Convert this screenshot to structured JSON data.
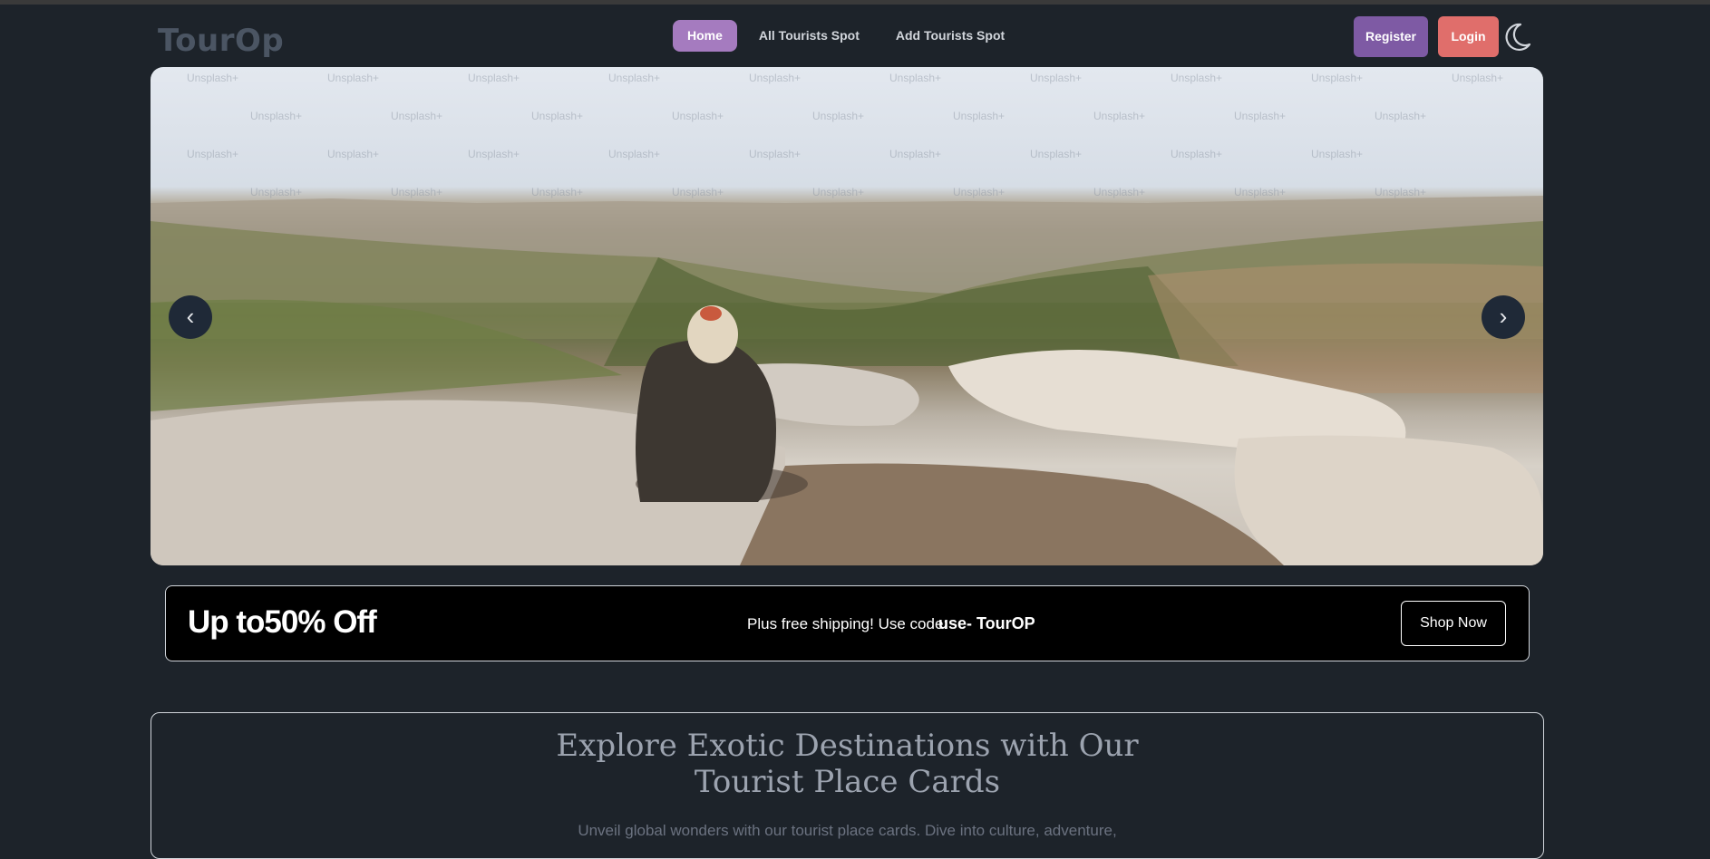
{
  "brand": {
    "logo": "TourOp"
  },
  "nav": {
    "links": [
      {
        "label": "Home",
        "active": true
      },
      {
        "label": "All Tourists Spot",
        "active": false
      },
      {
        "label": "Add Tourists Spot",
        "active": false
      }
    ],
    "register_label": "Register",
    "login_label": "Login",
    "theme_icon": "moon-icon"
  },
  "carousel": {
    "prev_label": "‹",
    "next_label": "›",
    "watermark": "Unsplash+"
  },
  "promo": {
    "title": "Up to50% Off",
    "text": "Plus free shipping! Use code:",
    "code": "use- TourOP",
    "button_label": "Shop Now"
  },
  "explore": {
    "title_line1": "Explore Exotic Destinations with Our",
    "title_line2": "Tourist Place Cards",
    "description": "Unveil global wonders with our tourist place cards. Dive into culture, adventure,"
  },
  "colors": {
    "background": "#1d232a",
    "home_active": "#a57bbf",
    "register": "#7e5aa4",
    "login": "#e06e6b"
  }
}
